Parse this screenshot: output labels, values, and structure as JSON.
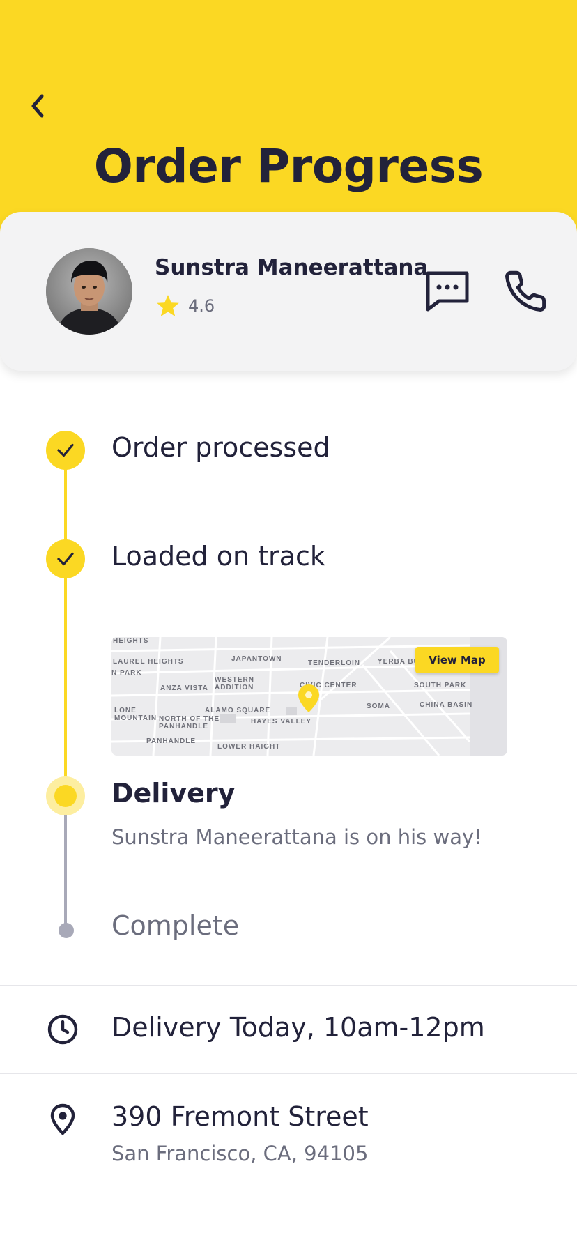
{
  "header": {
    "title": "Order Progress"
  },
  "driver": {
    "name": "Sunstra Maneerattana",
    "rating": "4.6"
  },
  "steps": [
    {
      "label": "Order processed",
      "status": "done"
    },
    {
      "label": "Loaded on track",
      "status": "done"
    },
    {
      "label": "Delivery",
      "status": "current",
      "subtitle": "Sunstra Maneerattana is on his way!"
    },
    {
      "label": "Complete",
      "status": "pending"
    }
  ],
  "map": {
    "button_label": "View Map",
    "labels": [
      "HEIGHTS",
      "LAUREL HEIGHTS",
      "JAPANTOWN",
      "TENDERLOIN",
      "YERBA BU",
      "N PARK",
      "WESTERN ADDITION",
      "CIVIC CENTER",
      "SOUTH PARK",
      "ANZA VISTA",
      "SOMA",
      "CHINA BASIN",
      "LONE MOUNTAIN",
      "ALAMO SQUARE",
      "NORTH OF THE PANHANDLE",
      "HAYES VALLEY",
      "PANHANDLE",
      "LOWER HAIGHT"
    ]
  },
  "delivery_window": "Delivery Today, 10am-12pm",
  "address": {
    "line1": "390 Fremont Street",
    "line2": "San Francisco, CA, 94105"
  },
  "colors": {
    "accent": "#fbd823",
    "text": "#22223a",
    "muted": "#6b6d7d",
    "pending": "#a8a9b8"
  },
  "icons": [
    "chevron-left-icon",
    "star-icon",
    "message-icon",
    "phone-icon",
    "check-icon",
    "clock-icon",
    "location-pin-icon"
  ]
}
